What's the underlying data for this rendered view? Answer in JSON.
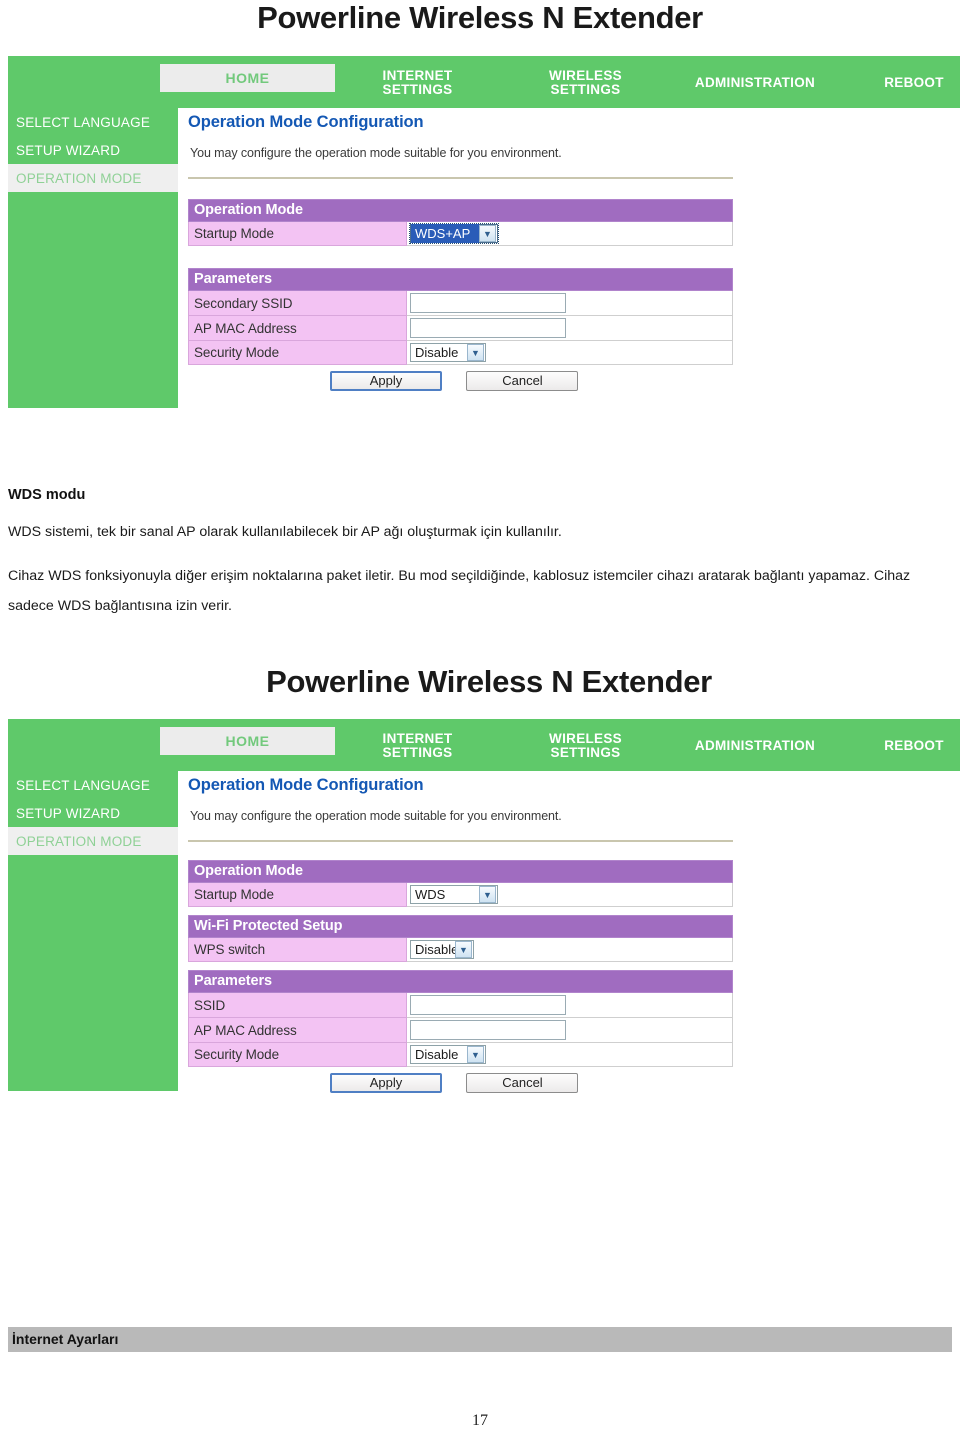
{
  "document": {
    "page_number": "17",
    "footer_label": "İnternet Ayarları"
  },
  "prose": {
    "heading": "WDS modu",
    "paragraph1": "WDS sistemi, tek bir sanal AP olarak kullanılabilecek bir AP ağı oluşturmak için kullanılır.",
    "paragraph2": "Cihaz WDS fonksiyonuyla diğer erişim noktalarına paket iletir. Bu mod seçildiğinde, kablosuz istemciler cihazı aratarak bağlantı yapamaz. Cihaz sadece WDS bağlantısına izin verir."
  },
  "colors": {
    "nav_green": "#5fc96a",
    "section_purple": "#a06cc0",
    "label_pink": "#f3c3f3",
    "title_blue": "#1458b4",
    "footer_gray": "#b9b9b9",
    "select_highlight": "#2a5cb8"
  },
  "screenshot1": {
    "product_title": "Powerline Wireless N Extender",
    "nav": {
      "home": "HOME",
      "internet_settings_line1": "INTERNET",
      "internet_settings_line2": "SETTINGS",
      "wireless_settings_line1": "WIRELESS",
      "wireless_settings_line2": "SETTINGS",
      "administration": "ADMINISTRATION",
      "reboot": "REBOOT"
    },
    "sidebar": [
      {
        "label": "SELECT LANGUAGE",
        "active": false
      },
      {
        "label": "SETUP WIZARD",
        "active": false
      },
      {
        "label": "OPERATION MODE",
        "active": true
      }
    ],
    "content": {
      "title": "Operation Mode Configuration",
      "description": "You may configure the operation mode suitable for you environment."
    },
    "operation_mode": {
      "section_title": "Operation Mode",
      "startup_mode_label": "Startup Mode",
      "startup_mode_value": "WDS+AP"
    },
    "parameters": {
      "section_title": "Parameters",
      "rows": [
        {
          "label": "Secondary SSID",
          "type": "text",
          "value": ""
        },
        {
          "label": "AP MAC Address",
          "type": "text",
          "value": ""
        },
        {
          "label": "Security Mode",
          "type": "select",
          "value": "Disable"
        }
      ]
    },
    "buttons": {
      "apply": "Apply",
      "cancel": "Cancel"
    }
  },
  "screenshot2": {
    "product_title": "Powerline Wireless N Extender",
    "nav": {
      "home": "HOME",
      "internet_settings_line1": "INTERNET",
      "internet_settings_line2": "SETTINGS",
      "wireless_settings_line1": "WIRELESS",
      "wireless_settings_line2": "SETTINGS",
      "administration": "ADMINISTRATION",
      "reboot": "REBOOT"
    },
    "sidebar": [
      {
        "label": "SELECT LANGUAGE",
        "active": false
      },
      {
        "label": "SETUP WIZARD",
        "active": false
      },
      {
        "label": "OPERATION MODE",
        "active": true
      }
    ],
    "content": {
      "title": "Operation Mode Configuration",
      "description": "You may configure the operation mode suitable for you environment."
    },
    "operation_mode": {
      "section_title": "Operation Mode",
      "startup_mode_label": "Startup Mode",
      "startup_mode_value": "WDS"
    },
    "wps": {
      "section_title": "Wi-Fi Protected Setup",
      "switch_label": "WPS switch",
      "switch_value": "Disable"
    },
    "parameters": {
      "section_title": "Parameters",
      "rows": [
        {
          "label": "SSID",
          "type": "text",
          "value": ""
        },
        {
          "label": "AP MAC Address",
          "type": "text",
          "value": ""
        },
        {
          "label": "Security Mode",
          "type": "select",
          "value": "Disable"
        }
      ]
    },
    "buttons": {
      "apply": "Apply",
      "cancel": "Cancel"
    }
  }
}
